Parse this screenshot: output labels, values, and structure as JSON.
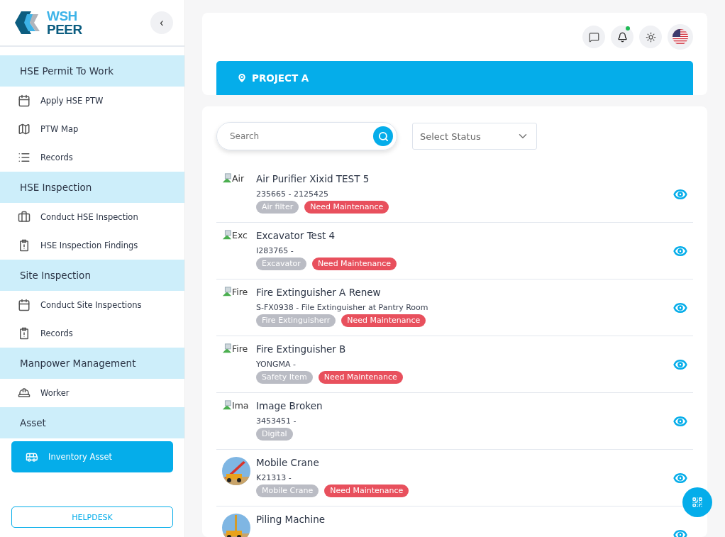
{
  "logo": {
    "line_1": "WSH",
    "line_2": "PEER"
  },
  "collapse_button": {
    "label": "‹"
  },
  "sidebar": {
    "sections": [
      {
        "title": "HSE Permit To Work",
        "items": [
          {
            "label": "Apply HSE PTW",
            "selected": false
          },
          {
            "label": "PTW Map",
            "selected": false
          },
          {
            "label": "Records",
            "selected": false
          }
        ]
      },
      {
        "title": "HSE Inspection",
        "items": [
          {
            "label": "Conduct HSE Inspection",
            "selected": false
          },
          {
            "label": "HSE Inspection Findings",
            "selected": false
          }
        ]
      },
      {
        "title": "Site Inspection",
        "items": [
          {
            "label": "Conduct Site Inspections",
            "selected": false
          },
          {
            "label": "Records",
            "selected": false
          }
        ]
      },
      {
        "title": "Manpower Management",
        "items": [
          {
            "label": "Worker",
            "selected": false
          }
        ]
      },
      {
        "title": "Asset",
        "items": [
          {
            "label": "Inventory Asset",
            "selected": true
          }
        ]
      }
    ]
  },
  "helpdesk": {
    "label": "HELPDESK"
  },
  "header": {
    "notifications": {
      "unread": true
    },
    "project": "PROJECT A"
  },
  "search": {
    "placeholder": "Search"
  },
  "status_select": {
    "placeholder": "Select Status"
  },
  "assets": [
    {
      "name": "Air Purifier Xixid TEST 5",
      "code": "235665 - 2125425",
      "image": {
        "kind": "broken",
        "alt": "Air"
      },
      "tags": [
        {
          "label": "Air filter",
          "kind": "category"
        },
        {
          "label": "Need Maintenance",
          "kind": "alert"
        }
      ]
    },
    {
      "name": "Excavator Test 4",
      "code": "I283765 -",
      "image": {
        "kind": "broken",
        "alt": "Exc"
      },
      "tags": [
        {
          "label": "Excavator",
          "kind": "category"
        },
        {
          "label": "Need Maintenance",
          "kind": "alert"
        }
      ]
    },
    {
      "name": "Fire Extinguisher A Renew",
      "code": "S-FX0938 - File Extinguisher at Pantry Room",
      "image": {
        "kind": "broken",
        "alt": "Fire"
      },
      "tags": [
        {
          "label": "Fire Extinguisherr",
          "kind": "category"
        },
        {
          "label": "Need Maintenance",
          "kind": "alert"
        }
      ]
    },
    {
      "name": "Fire Extinguisher B",
      "code": "YONGMA -",
      "image": {
        "kind": "broken",
        "alt": "Fire"
      },
      "tags": [
        {
          "label": "Safety Item",
          "kind": "category"
        },
        {
          "label": "Need Maintenance",
          "kind": "alert"
        }
      ]
    },
    {
      "name": "Image Broken",
      "code": "3453451 -",
      "image": {
        "kind": "broken",
        "alt": "Ima"
      },
      "tags": [
        {
          "label": "Digital",
          "kind": "category"
        }
      ]
    },
    {
      "name": "Mobile Crane",
      "code": "K21313 -",
      "image": {
        "kind": "picture"
      },
      "tags": [
        {
          "label": "Mobile Crane",
          "kind": "category"
        },
        {
          "label": "Need Maintenance",
          "kind": "alert"
        }
      ]
    },
    {
      "name": "Piling Machine",
      "image": {
        "kind": "picture"
      }
    }
  ]
}
